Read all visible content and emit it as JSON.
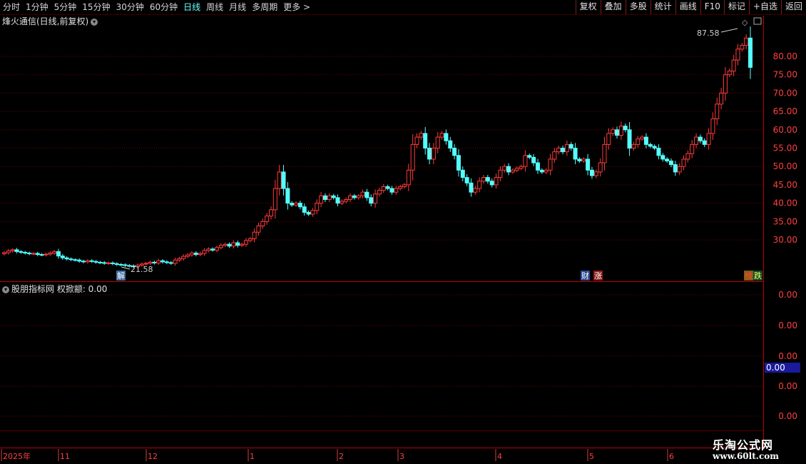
{
  "toolbar": {
    "periods": [
      "分时",
      "1分钟",
      "5分钟",
      "15分钟",
      "30分钟",
      "60分钟",
      "日线",
      "周线",
      "月线",
      "多周期",
      "更多 >"
    ],
    "active_period": "日线",
    "buttons": [
      "复权",
      "叠加",
      "多股",
      "统计",
      "画线",
      "F10",
      "标记",
      "+自选",
      "返回"
    ]
  },
  "stock": {
    "title": "烽火通信(日线,前复权)"
  },
  "indicator": {
    "title": "股朋指标网  权掀颛: 0.00",
    "value_badge": "0.00"
  },
  "price_axis": {
    "labels": [
      "80.00",
      "75.00",
      "70.00",
      "65.00",
      "60.00",
      "55.00",
      "50.00",
      "45.00",
      "40.00",
      "35.00",
      "30.00"
    ]
  },
  "indicator_axis": {
    "labels": [
      "0.00",
      "0.00",
      "0.00",
      "0.00",
      "0.00"
    ]
  },
  "annotations": {
    "high": "87.58",
    "low": "21.58"
  },
  "event_markers": {
    "jie": "解",
    "cai": "财",
    "zhang": "涨",
    "bang": "榜",
    "die": "跌"
  },
  "date_axis": {
    "labels": [
      "2025年",
      "11",
      "12",
      "1",
      "2",
      "3",
      "4",
      "5",
      "6"
    ]
  },
  "logo": {
    "line1": "乐淘公式网",
    "line2": "www.60lt.com"
  },
  "colors": {
    "up": "#ff3b3b",
    "down": "#54ffff",
    "grid": "#6e0000",
    "panel_border": "#c00000"
  },
  "chart_data": {
    "type": "candlestick",
    "title": "烽火通信(日线,前复权)",
    "ylim": [
      22,
      88
    ],
    "y_ticks": [
      30,
      35,
      40,
      45,
      50,
      55,
      60,
      65,
      70,
      75,
      80
    ],
    "x_ticks": [
      "2025年",
      "11",
      "12",
      "1",
      "2",
      "3",
      "4",
      "5",
      "6"
    ],
    "high": 87.58,
    "low": 21.58,
    "closes": [
      26.5,
      27.0,
      27.3,
      26.8,
      26.6,
      26.4,
      26.2,
      26.3,
      26.0,
      25.9,
      26.1,
      26.4,
      26.8,
      25.6,
      25.1,
      24.8,
      24.6,
      24.5,
      24.2,
      24.0,
      24.3,
      24.1,
      23.9,
      23.8,
      23.6,
      23.7,
      23.5,
      23.3,
      23.2,
      23.0,
      22.9,
      22.7,
      23.1,
      23.4,
      23.6,
      23.9,
      23.7,
      24.3,
      24.0,
      23.8,
      23.6,
      24.5,
      24.9,
      25.5,
      25.9,
      26.4,
      26.0,
      26.3,
      27.1,
      27.5,
      27.2,
      27.9,
      28.5,
      28.8,
      28.3,
      29.2,
      28.5,
      28.8,
      29.8,
      30.3,
      32.1,
      33.8,
      35.0,
      36.5,
      38.2,
      44.0,
      48.5,
      44.0,
      40.0,
      39.5,
      40.0,
      39.0,
      37.5,
      37.0,
      38.0,
      40.0,
      42.0,
      41.0,
      42.0,
      41.5,
      40.0,
      40.5,
      41.0,
      42.0,
      41.5,
      42.0,
      43.0,
      41.5,
      40.0,
      42.5,
      43.5,
      44.5,
      44.0,
      43.0,
      44.0,
      44.5,
      45.0,
      49.0,
      56.0,
      58.0,
      59.0,
      55.0,
      52.0,
      55.0,
      58.0,
      59.0,
      57.0,
      55.0,
      53.0,
      49.0,
      47.0,
      45.5,
      43.0,
      44.0,
      46.0,
      47.0,
      46.0,
      45.0,
      47.0,
      49.0,
      50.0,
      48.5,
      49.0,
      49.5,
      50.0,
      53.0,
      52.5,
      51.0,
      49.0,
      48.5,
      49.0,
      52.0,
      54.0,
      55.0,
      54.0,
      56.0,
      55.0,
      52.0,
      51.5,
      52.0,
      49.0,
      47.5,
      48.5,
      51.0,
      56.0,
      59.0,
      60.0,
      58.5,
      61.0,
      60.0,
      55.0,
      56.0,
      57.5,
      58.0,
      56.0,
      55.5,
      55.0,
      53.0,
      52.0,
      51.5,
      50.5,
      48.5,
      50.0,
      52.0,
      53.5,
      56.0,
      58.0,
      57.0,
      56.0,
      59.0,
      63.0,
      67.0,
      70.0,
      75.0,
      76.0,
      79.0,
      82.0,
      83.0,
      85.0,
      77.0
    ]
  }
}
